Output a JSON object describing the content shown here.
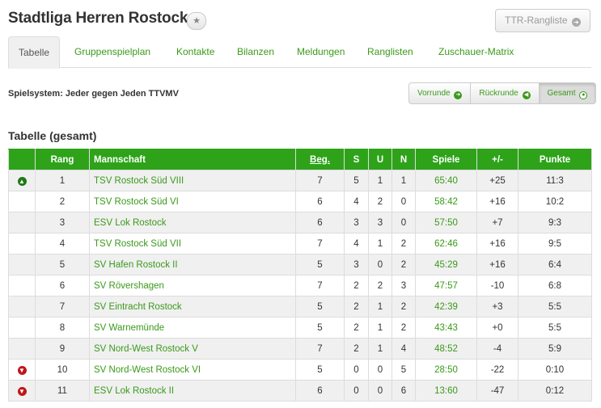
{
  "page": {
    "title": "Stadtliga Herren Rostock",
    "ttr_button": "TTR-Rangliste"
  },
  "tabs": [
    {
      "label": "Tabelle",
      "active": true
    },
    {
      "label": "Gruppenspielplan"
    },
    {
      "label": "Kontakte"
    },
    {
      "label": "Bilanzen"
    },
    {
      "label": "Meldungen"
    },
    {
      "label": "Ranglisten"
    },
    {
      "label": "Zuschauer-Matrix"
    }
  ],
  "spielsystem": "Spielsystem: Jeder gegen Jeden TTVMV",
  "round_buttons": [
    {
      "label": "Vorrunde",
      "icon": "arrow-right-circle-icon"
    },
    {
      "label": "Rückrunde",
      "icon": "arrow-left-circle-icon"
    },
    {
      "label": "Gesamt",
      "icon": "dot-circle-icon",
      "active": true
    }
  ],
  "table": {
    "title": "Tabelle (gesamt)",
    "headers": {
      "tendenz": "",
      "rang": "Rang",
      "mannschaft": "Mannschaft",
      "beg": "Beg.",
      "s": "S",
      "u": "U",
      "n": "N",
      "spiele": "Spiele",
      "diff": "+/-",
      "punkte": "Punkte"
    },
    "rows": [
      {
        "tendenz": "up",
        "rang": "1",
        "mannschaft": "TSV Rostock Süd VIII",
        "beg": "7",
        "s": "5",
        "u": "1",
        "n": "1",
        "spiele": "65:40",
        "diff": "+25",
        "punkte": "11:3"
      },
      {
        "tendenz": "",
        "rang": "2",
        "mannschaft": "TSV Rostock Süd VI",
        "beg": "6",
        "s": "4",
        "u": "2",
        "n": "0",
        "spiele": "58:42",
        "diff": "+16",
        "punkte": "10:2"
      },
      {
        "tendenz": "",
        "rang": "3",
        "mannschaft": "ESV Lok Rostock",
        "beg": "6",
        "s": "3",
        "u": "3",
        "n": "0",
        "spiele": "57:50",
        "diff": "+7",
        "punkte": "9:3"
      },
      {
        "tendenz": "",
        "rang": "4",
        "mannschaft": "TSV Rostock Süd VII",
        "beg": "7",
        "s": "4",
        "u": "1",
        "n": "2",
        "spiele": "62:46",
        "diff": "+16",
        "punkte": "9:5"
      },
      {
        "tendenz": "",
        "rang": "5",
        "mannschaft": "SV Hafen Rostock II",
        "beg": "5",
        "s": "3",
        "u": "0",
        "n": "2",
        "spiele": "45:29",
        "diff": "+16",
        "punkte": "6:4"
      },
      {
        "tendenz": "",
        "rang": "6",
        "mannschaft": "SV Rövershagen",
        "beg": "7",
        "s": "2",
        "u": "2",
        "n": "3",
        "spiele": "47:57",
        "diff": "-10",
        "punkte": "6:8"
      },
      {
        "tendenz": "",
        "rang": "7",
        "mannschaft": "SV Eintracht Rostock",
        "beg": "5",
        "s": "2",
        "u": "1",
        "n": "2",
        "spiele": "42:39",
        "diff": "+3",
        "punkte": "5:5"
      },
      {
        "tendenz": "",
        "rang": "8",
        "mannschaft": "SV Warnemünde",
        "beg": "5",
        "s": "2",
        "u": "1",
        "n": "2",
        "spiele": "43:43",
        "diff": "+0",
        "punkte": "5:5"
      },
      {
        "tendenz": "",
        "rang": "9",
        "mannschaft": "SV Nord-West Rostock V",
        "beg": "7",
        "s": "2",
        "u": "1",
        "n": "4",
        "spiele": "48:52",
        "diff": "-4",
        "punkte": "5:9"
      },
      {
        "tendenz": "down",
        "rang": "10",
        "mannschaft": "SV Nord-West Rostock VI",
        "beg": "5",
        "s": "0",
        "u": "0",
        "n": "5",
        "spiele": "28:50",
        "diff": "-22",
        "punkte": "0:10"
      },
      {
        "tendenz": "down",
        "rang": "11",
        "mannschaft": "ESV Lok Rostock II",
        "beg": "6",
        "s": "0",
        "u": "0",
        "n": "6",
        "spiele": "13:60",
        "diff": "-47",
        "punkte": "0:12"
      }
    ]
  },
  "colors": {
    "accent_green": "#2ea31a",
    "link_green": "#3a9a1a",
    "up_green": "#1e7a14",
    "down_red": "#c0161a"
  }
}
